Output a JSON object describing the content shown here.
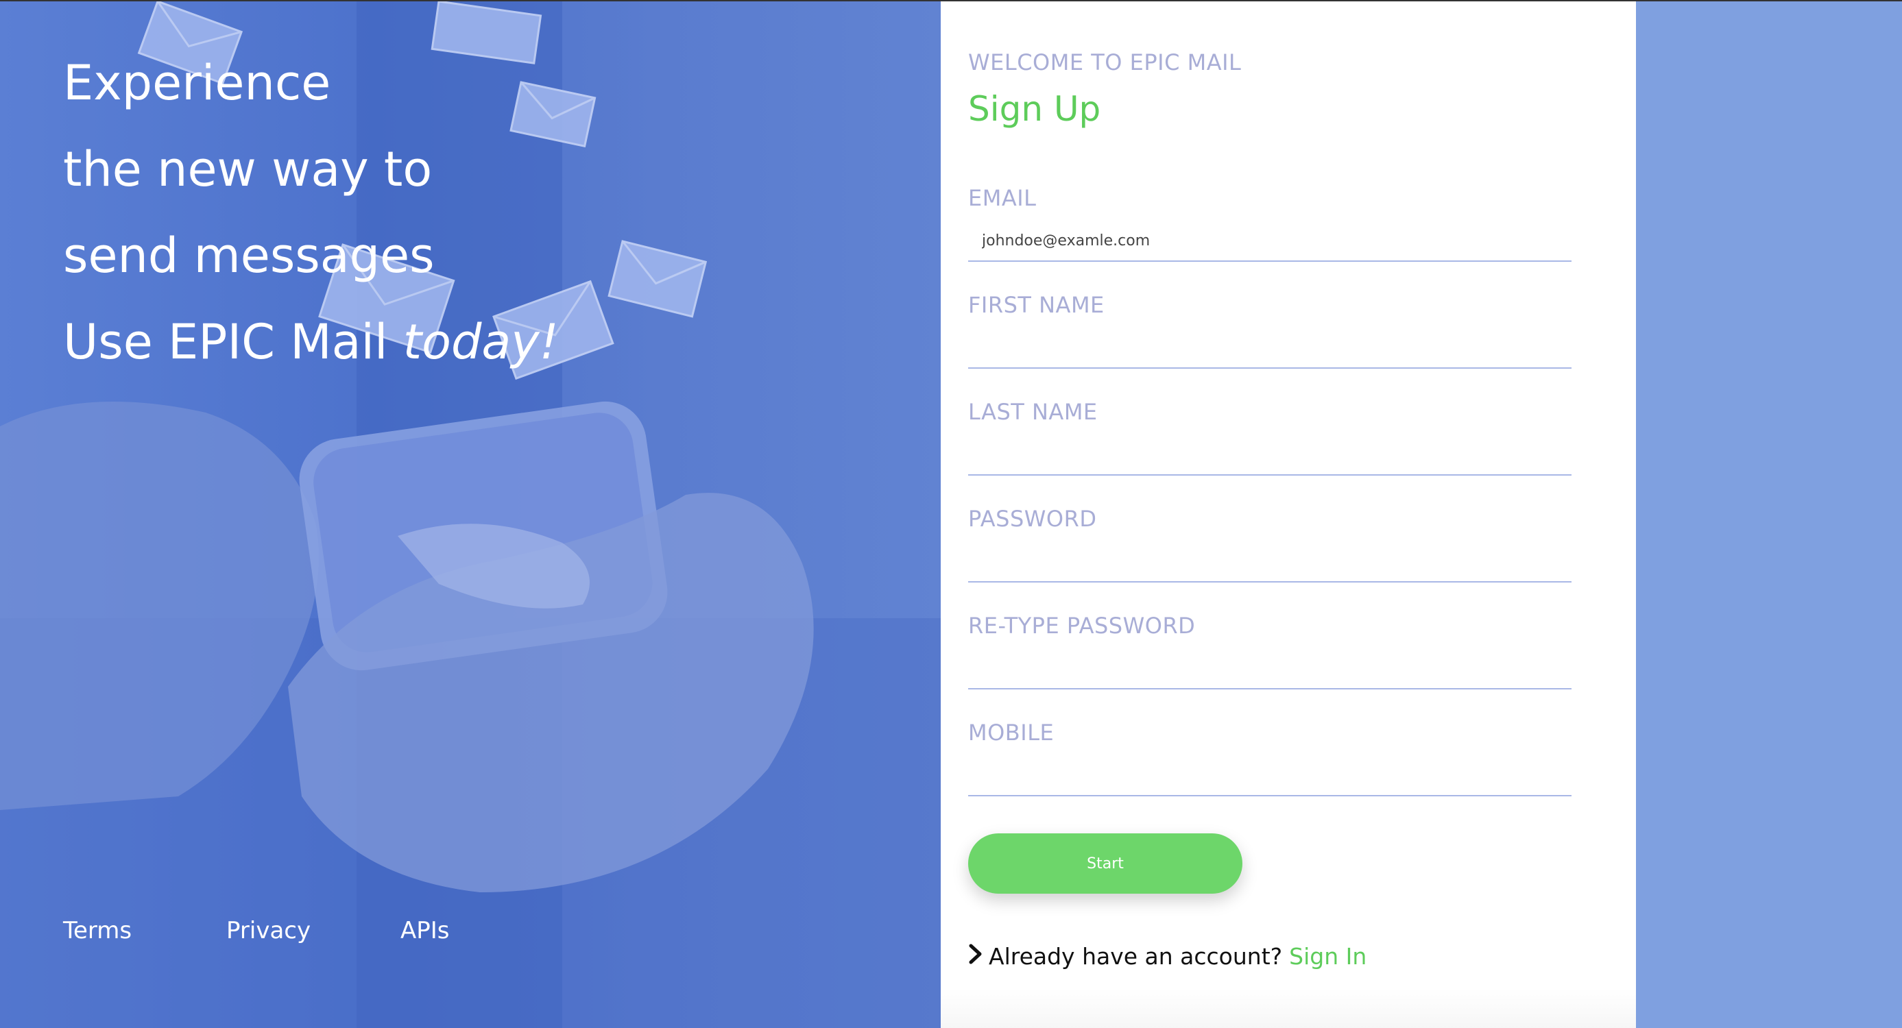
{
  "hero": {
    "line1": "Experience",
    "line2": "the new way to",
    "line3": "send messages",
    "line4_prefix": "Use EPIC Mail ",
    "line4_emphasis": "today!",
    "footer_links": [
      "Terms",
      "Privacy",
      "APIs"
    ]
  },
  "form": {
    "welcome": "WELCOME TO EPIC MAIL",
    "title": "Sign Up",
    "fields": [
      {
        "label": "EMAIL",
        "value": "johndoe@examle.com"
      },
      {
        "label": "FIRST NAME",
        "value": ""
      },
      {
        "label": "LAST NAME",
        "value": ""
      },
      {
        "label": "PASSWORD",
        "value": ""
      },
      {
        "label": "RE-TYPE PASSWORD",
        "value": ""
      },
      {
        "label": "MOBILE",
        "value": ""
      }
    ],
    "submit_label": "Start",
    "already_text": "Already have an account?",
    "signin_label": "Sign In"
  },
  "colors": {
    "accent_green": "#5dcc5a",
    "label_lavender": "#a8add6",
    "hero_blue": "#4d72cc",
    "page_blue": "#7fa0e0"
  }
}
